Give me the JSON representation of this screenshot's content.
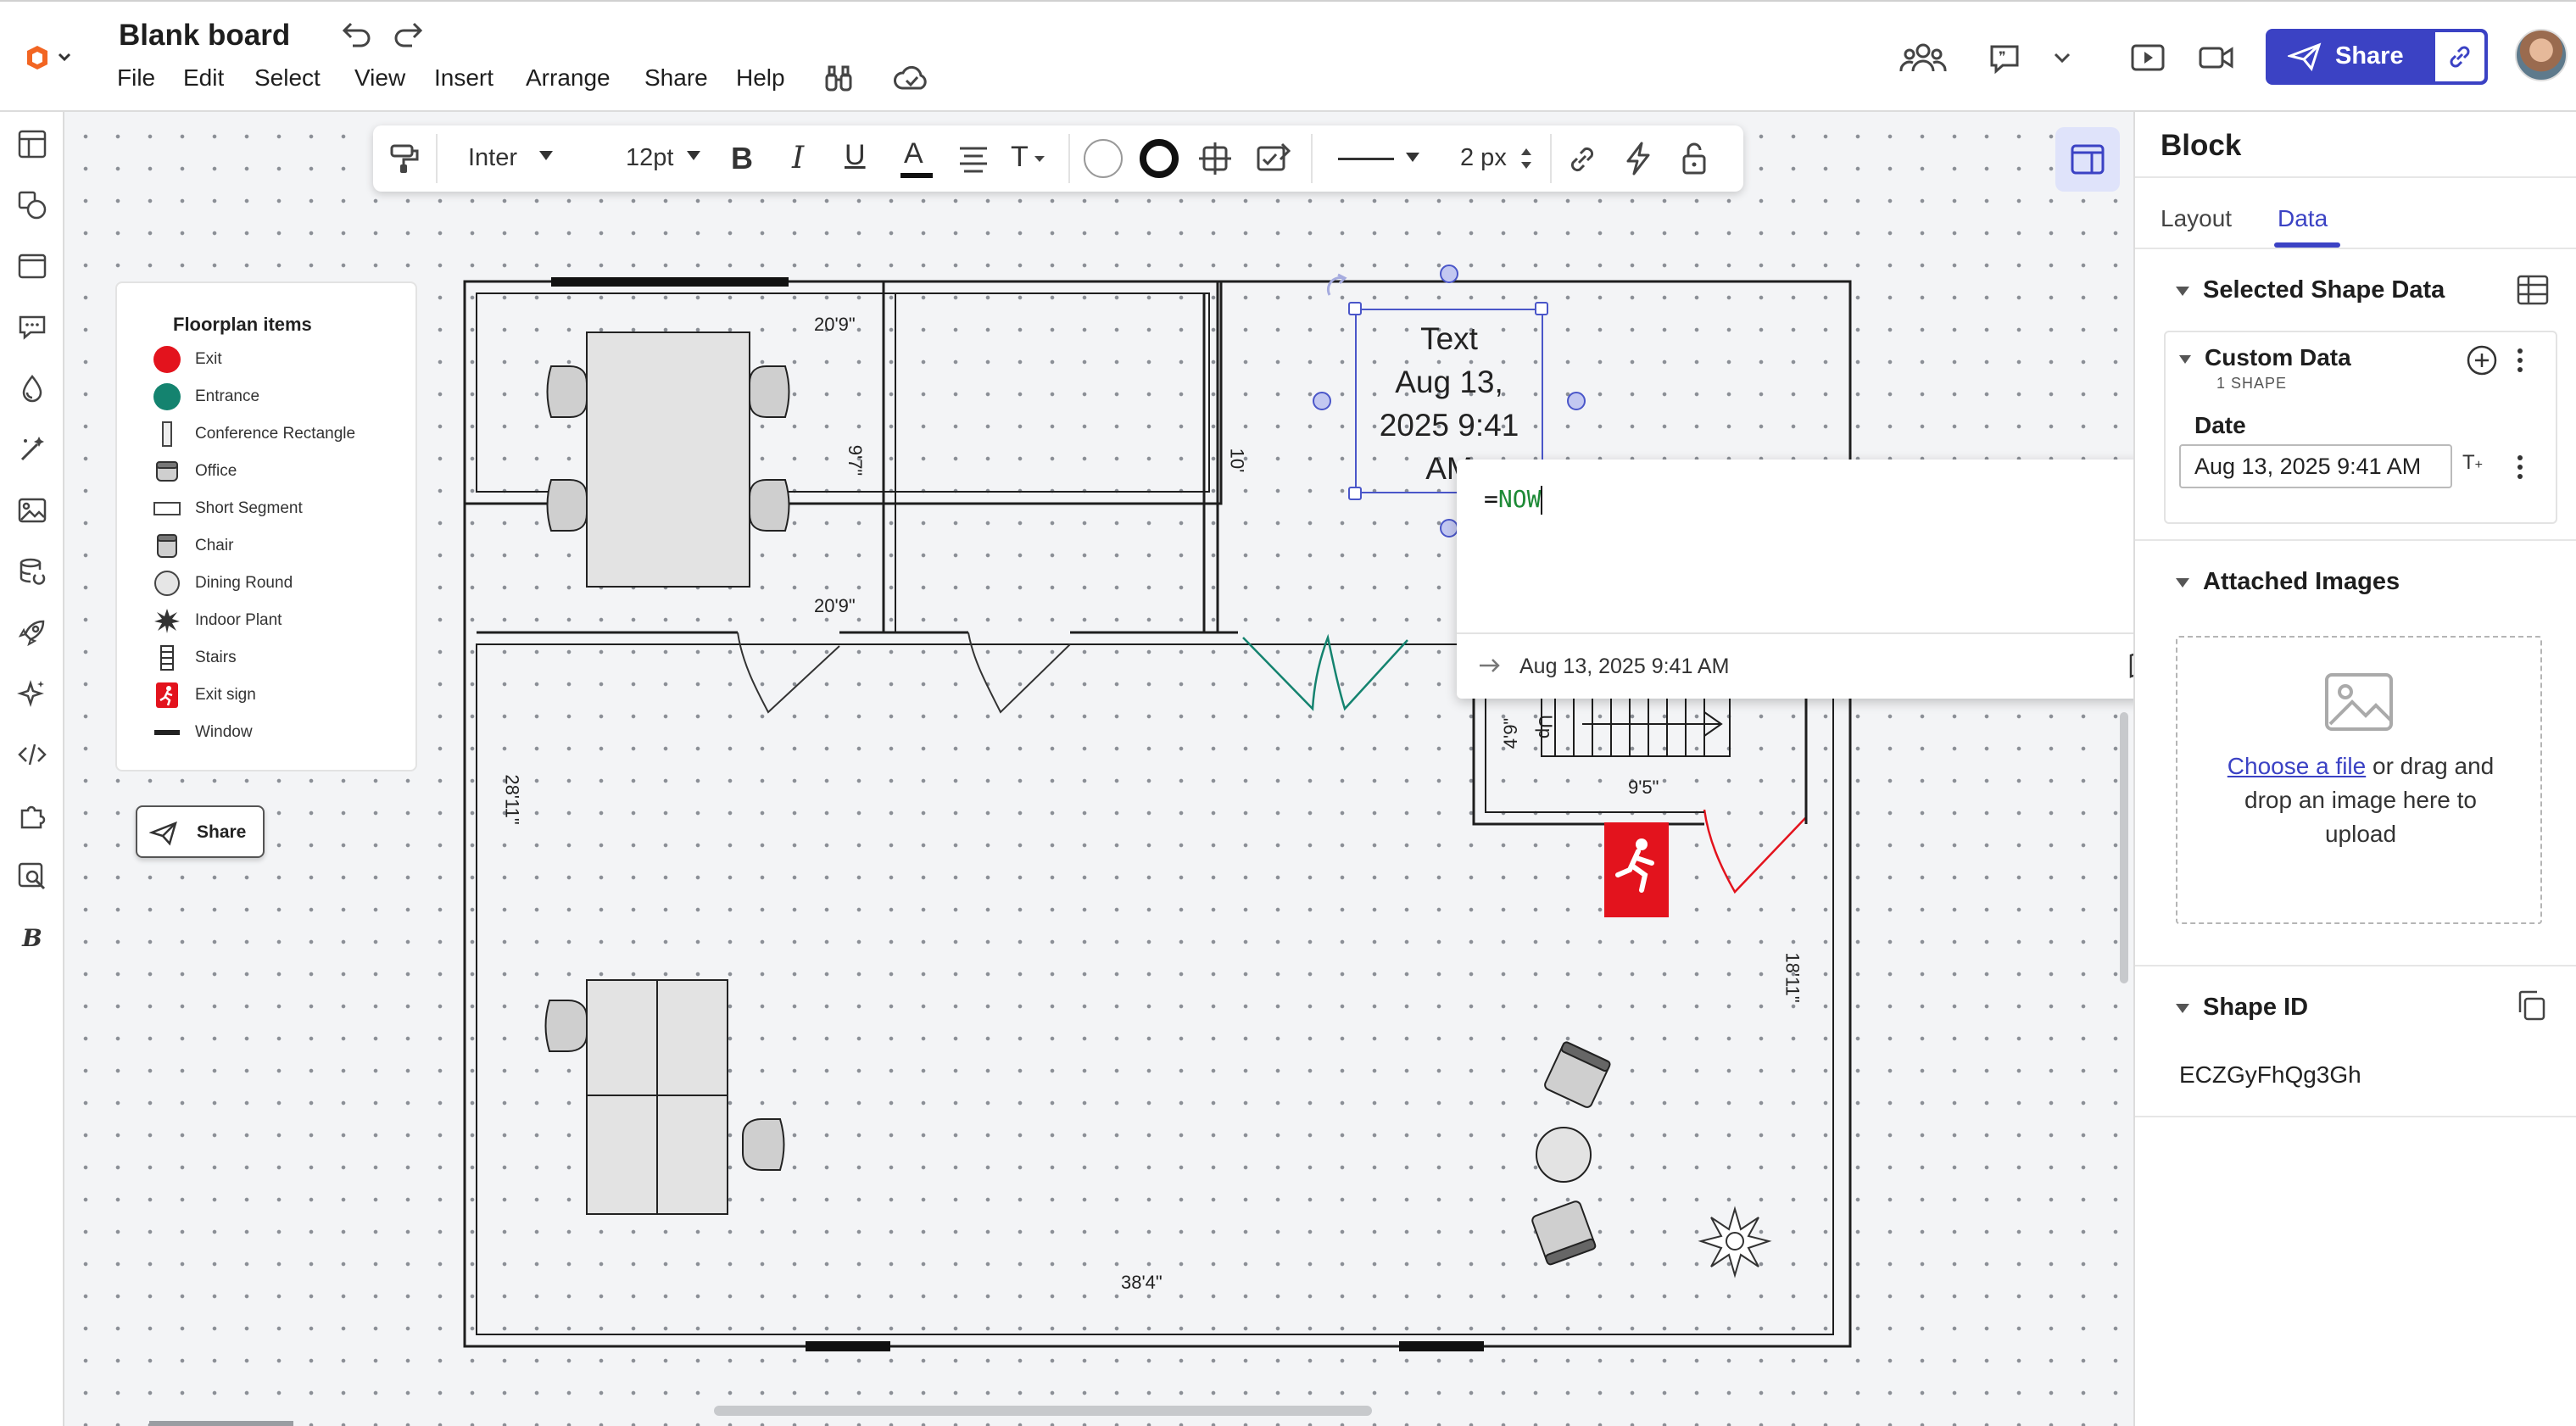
{
  "app": {
    "title": "Blank board"
  },
  "menu": [
    "File",
    "Edit",
    "Select",
    "View",
    "Insert",
    "Arrange",
    "Share",
    "Help"
  ],
  "header": {
    "share_label": "Share"
  },
  "toolbar": {
    "font": "Inter",
    "font_size": "12pt",
    "line_width": "2 px"
  },
  "legend": {
    "title": "Floorplan items",
    "items": [
      "Exit",
      "Entrance",
      "Conference Rectangle",
      "Office",
      "Short Segment",
      "Chair",
      "Dining Round",
      "Indoor Plant",
      "Stairs",
      "Exit sign",
      "Window"
    ],
    "colors": {
      "exit": "#e3131d",
      "entrance": "#14836f"
    }
  },
  "canvas_share": {
    "label": "Share"
  },
  "floorplan": {
    "dims": {
      "room1_top": "20'9\"",
      "room1_side": "9'7\"",
      "room1_bottom": "20'9\"",
      "room2_side": "10'",
      "main_side": "28'11\"",
      "main_bottom": "38'4\"",
      "right_side": "18'11\"",
      "stair_w": "9'5\"",
      "stair_h": "4'9\"",
      "stair_label": "Up"
    }
  },
  "selected_text": {
    "line1": "Text",
    "line2": "Aug 13,",
    "line3": "2025 9:41",
    "line4": "AM"
  },
  "formula": {
    "prefix": "=",
    "func": "NOW",
    "result": "Aug 13, 2025 9:41 AM"
  },
  "panel": {
    "title": "Block",
    "tabs": [
      "Layout",
      "Data"
    ],
    "active_tab": "Data",
    "selected_shape_data": "Selected Shape Data",
    "custom_data": "Custom Data",
    "shape_count": "1 SHAPE",
    "date_label": "Date",
    "date_value": "Aug 13, 2025 9:41 AM",
    "attached_images": "Attached Images",
    "choose_file": "Choose a file",
    "upload_rest": " or drag and drop an image here to upload",
    "shape_id_label": "Shape ID",
    "shape_id": "ECZGyFhQg3Gh"
  },
  "colors": {
    "accent": "#3b42c4",
    "formula_green": "#1d8a36",
    "wall": "#1e1e1e"
  }
}
